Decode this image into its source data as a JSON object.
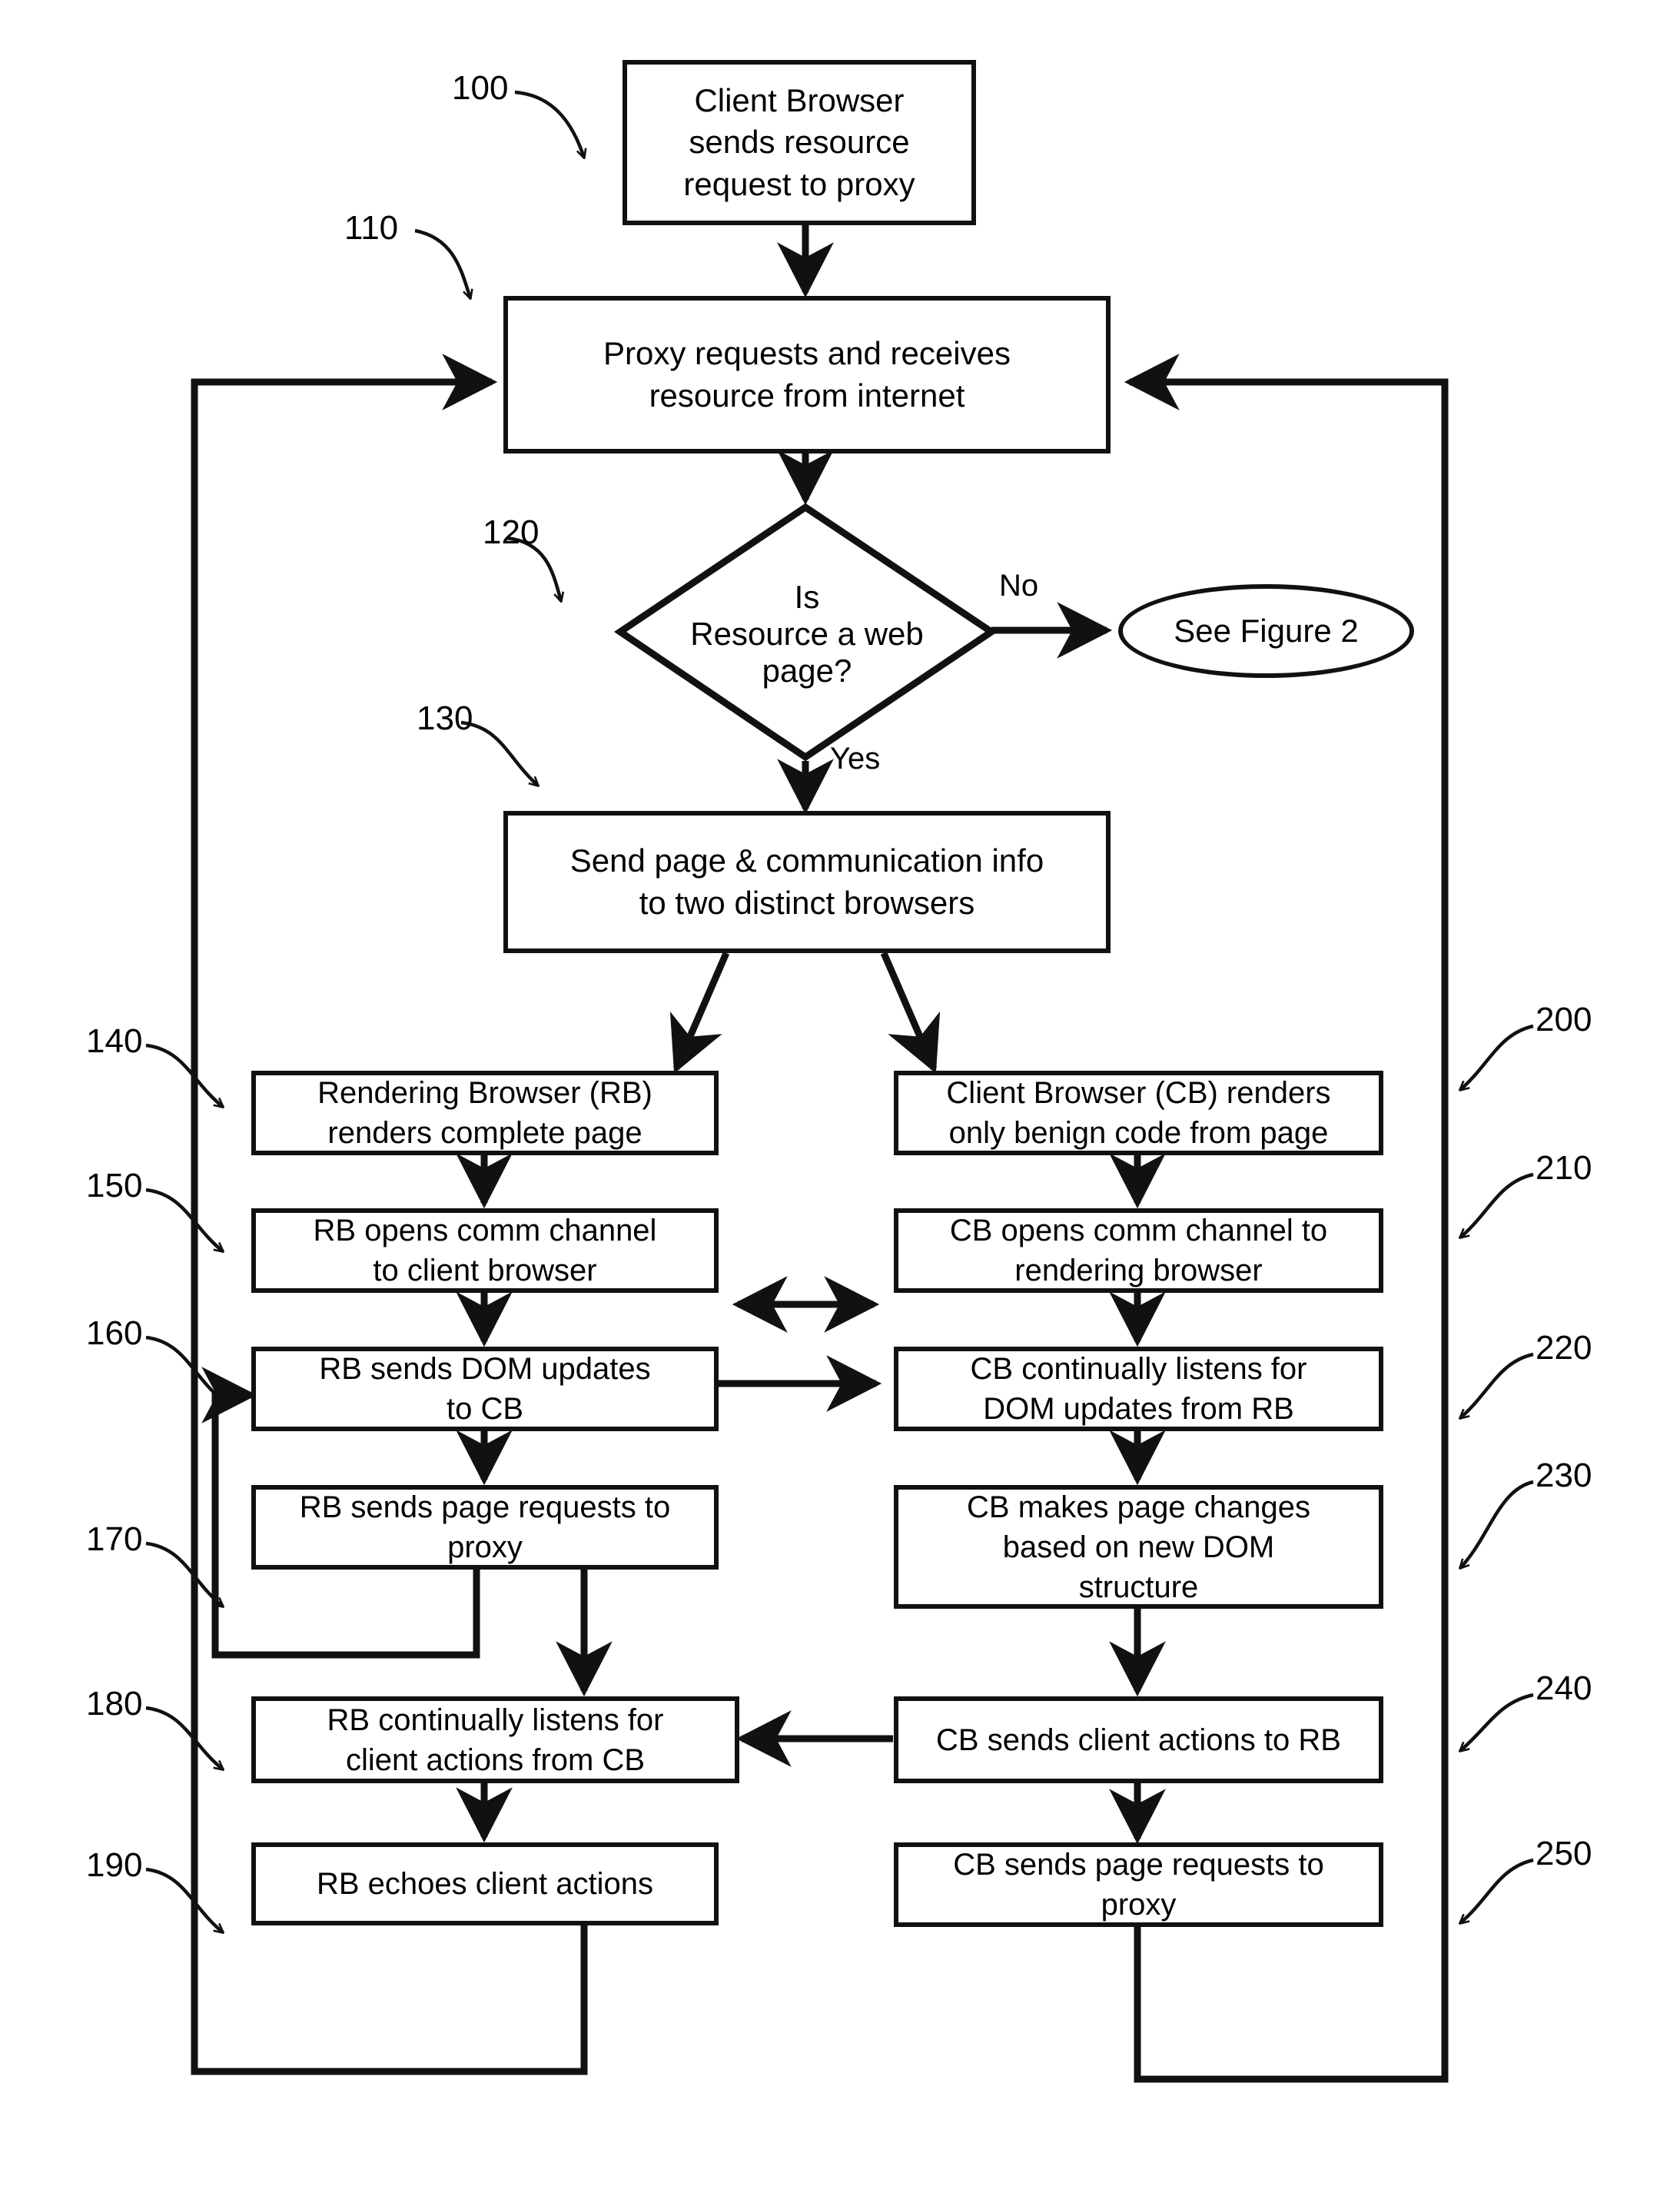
{
  "figure": {
    "type": "flowchart",
    "title": "Proxy / dual-browser rendering process flowchart"
  },
  "nodes": [
    {
      "ref": "100",
      "shape": "rect",
      "text": "Client Browser sends resource request to proxy",
      "lines": [
        "Client Browser",
        "sends resource",
        "request to proxy"
      ]
    },
    {
      "ref": "110",
      "shape": "rect",
      "text": "Proxy requests and receives resource from internet",
      "lines": [
        "Proxy requests and receives",
        "resource from internet"
      ]
    },
    {
      "ref": "120",
      "shape": "diamond",
      "text": "Is Resource a web page?",
      "lines": [
        "Is",
        "Resource a web",
        "page?"
      ]
    },
    {
      "ref": "",
      "shape": "ellipse",
      "text": "See Figure 2",
      "lines": [
        "See Figure 2"
      ]
    },
    {
      "ref": "130",
      "shape": "rect",
      "text": "Send page & communication info to two distinct browsers",
      "lines": [
        "Send page & communication info",
        "to two distinct browsers"
      ]
    },
    {
      "ref": "140",
      "shape": "rect",
      "text": "Rendering Browser (RB) renders  complete page",
      "lines": [
        "Rendering Browser (RB)",
        "renders  complete page"
      ]
    },
    {
      "ref": "150",
      "shape": "rect",
      "text": "RB opens comm channel to client  browser",
      "lines": [
        "RB opens comm channel",
        "to client  browser"
      ]
    },
    {
      "ref": "160",
      "shape": "rect",
      "text": "RB sends DOM updates to CB",
      "lines": [
        "RB sends DOM updates",
        "to CB"
      ]
    },
    {
      "ref": "170",
      "shape": "rect",
      "text": "RB sends page requests to proxy",
      "lines": [
        "RB sends page requests to",
        "proxy"
      ]
    },
    {
      "ref": "180",
      "shape": "rect",
      "text": "RB continually listens for client actions from CB",
      "lines": [
        "RB continually listens for",
        "client actions from CB"
      ]
    },
    {
      "ref": "190",
      "shape": "rect",
      "text": "RB echoes client actions",
      "lines": [
        "RB echoes client actions"
      ]
    },
    {
      "ref": "200",
      "shape": "rect",
      "text": "Client Browser (CB) renders only benign code from page",
      "lines": [
        "Client Browser (CB) renders",
        "only benign code from page"
      ]
    },
    {
      "ref": "210",
      "shape": "rect",
      "text": "CB opens comm channel to rendering browser",
      "lines": [
        "CB opens comm channel to",
        "rendering browser"
      ]
    },
    {
      "ref": "220",
      "shape": "rect",
      "text": "CB continually listens for DOM updates from RB",
      "lines": [
        "CB continually listens for",
        "DOM updates from RB"
      ]
    },
    {
      "ref": "230",
      "shape": "rect",
      "text": "CB makes page changes based on new DOM structure",
      "lines": [
        "CB makes page changes",
        "based on new DOM",
        "structure"
      ]
    },
    {
      "ref": "240",
      "shape": "rect",
      "text": "CB sends client actions to RB",
      "lines": [
        "CB sends client actions to RB"
      ]
    },
    {
      "ref": "250",
      "shape": "rect",
      "text": "CB sends page requests to proxy",
      "lines": [
        "CB sends page requests to",
        "proxy"
      ]
    }
  ],
  "box100": {
    "l1": "Client Browser",
    "l2": "sends resource",
    "l3": "request to proxy"
  },
  "box110": {
    "l1": "Proxy requests and receives",
    "l2": "resource from internet"
  },
  "diamond120": {
    "l1": "Is",
    "l2": "Resource a web",
    "l3": "page?"
  },
  "ellipse_fig2": {
    "label": "See Figure 2"
  },
  "box130": {
    "l1": "Send page & communication info",
    "l2": "to two distinct browsers"
  },
  "box140": {
    "l1": "Rendering Browser (RB)",
    "l2": "renders  complete page"
  },
  "box150": {
    "l1": "RB opens comm channel",
    "l2": "to client  browser"
  },
  "box160": {
    "l1": "RB sends DOM updates",
    "l2": "to CB"
  },
  "box170": {
    "l1": "RB sends page requests to",
    "l2": "proxy"
  },
  "box180": {
    "l1": "RB continually listens for",
    "l2": "client actions from CB"
  },
  "box190": {
    "l1": "RB echoes client actions"
  },
  "box200": {
    "l1": "Client Browser (CB) renders",
    "l2": "only benign code from page"
  },
  "box210": {
    "l1": "CB opens comm channel to",
    "l2": "rendering browser"
  },
  "box220": {
    "l1": "CB continually listens for",
    "l2": "DOM updates from RB"
  },
  "box230": {
    "l1": "CB makes page changes",
    "l2": "based on new DOM",
    "l3": "structure"
  },
  "box240": {
    "l1": "CB sends client actions to RB"
  },
  "box250": {
    "l1": "CB sends page requests to",
    "l2": "proxy"
  },
  "edge_labels": {
    "no": "No",
    "yes": "Yes"
  },
  "refs": {
    "r100": "100",
    "r110": "110",
    "r120": "120",
    "r130": "130",
    "r140": "140",
    "r150": "150",
    "r160": "160",
    "r170": "170",
    "r180": "180",
    "r190": "190",
    "r200": "200",
    "r210": "210",
    "r220": "220",
    "r230": "230",
    "r240": "240",
    "r250": "250"
  },
  "colors": {
    "stroke": "#111111",
    "fill": "#ffffff",
    "text": "#000000"
  }
}
